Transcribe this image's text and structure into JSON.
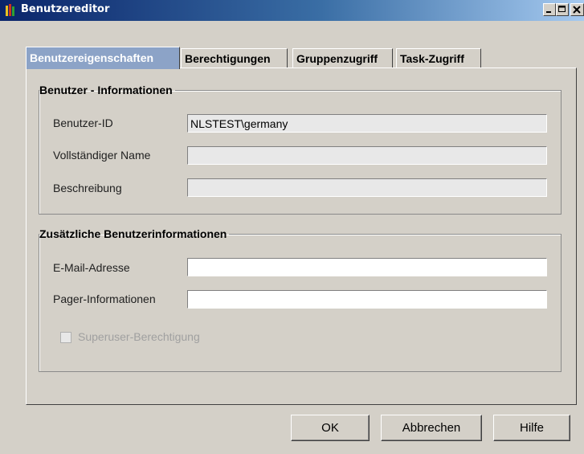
{
  "window": {
    "title": "Benutzereditor",
    "icon": "app-icon",
    "controls": [
      "minimize-icon",
      "maximize-icon",
      "close-icon"
    ]
  },
  "tabs": [
    {
      "label": "Benutzereigenschaften",
      "active": true
    },
    {
      "label": "Berechtigungen",
      "active": false
    },
    {
      "label": "Gruppenzugriff",
      "active": false
    },
    {
      "label": "Task-Zugriff",
      "active": false
    }
  ],
  "user_info": {
    "legend": "Benutzer - Informationen",
    "user_id_label": "Benutzer-ID",
    "user_id_value": "NLSTEST\\germany",
    "full_name_label": "Vollständiger Name",
    "full_name_value": "",
    "description_label": "Beschreibung",
    "description_value": ""
  },
  "extra_info": {
    "legend": "Zusätzliche Benutzerinformationen",
    "email_label": "E-Mail-Adresse",
    "email_value": "",
    "pager_label": "Pager-Informationen",
    "pager_value": "",
    "superuser_label": "Superuser-Berechtigung",
    "superuser_checked": false,
    "superuser_enabled": false
  },
  "buttons": {
    "ok": "OK",
    "cancel": "Abbrechen",
    "help": "Hilfe"
  }
}
